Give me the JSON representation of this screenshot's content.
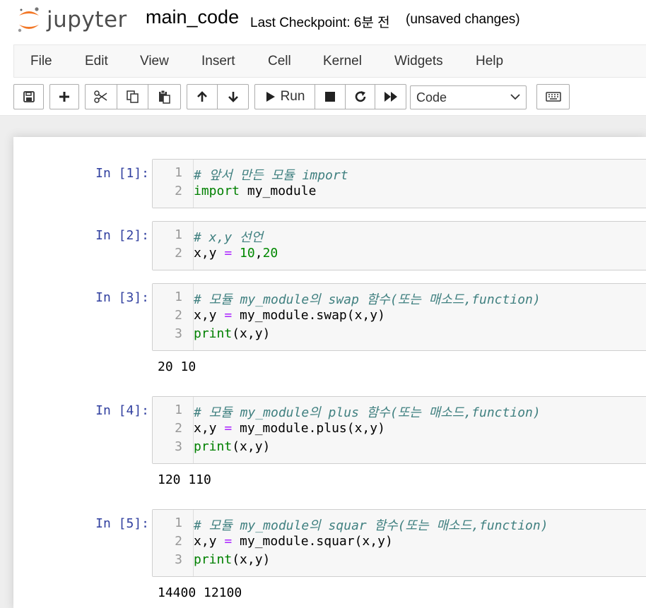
{
  "header": {
    "logo_text": "jupyter",
    "notebook_name": "main_code",
    "checkpoint": "Last Checkpoint: 6분 전",
    "unsaved": "(unsaved changes)"
  },
  "menu": [
    "File",
    "Edit",
    "View",
    "Insert",
    "Cell",
    "Kernel",
    "Widgets",
    "Help"
  ],
  "toolbar": {
    "run_label": "Run",
    "cell_type": "Code",
    "icons": [
      "save-icon",
      "plus-icon",
      "cut-icon",
      "copy-icon",
      "paste-icon",
      "arrow-up-icon",
      "arrow-down-icon",
      "run-icon",
      "stop-icon",
      "restart-icon",
      "fast-forward-icon",
      "keyboard-icon"
    ]
  },
  "colors": {
    "comment": "#408080",
    "keyword": "#008000",
    "operator": "#aa22ff",
    "number": "#008800",
    "prompt": "#303f9f"
  },
  "cells": [
    {
      "prompt": "In [1]:",
      "lines": [
        [
          {
            "t": "cm",
            "v": "# 앞서 만든 모듈 import"
          }
        ],
        [
          {
            "t": "kw",
            "v": "import"
          },
          {
            "t": "tx",
            "v": " my_module"
          }
        ]
      ],
      "output": ""
    },
    {
      "prompt": "In [2]:",
      "lines": [
        [
          {
            "t": "cm",
            "v": "# x,y 선언"
          }
        ],
        [
          {
            "t": "tx",
            "v": "x,y "
          },
          {
            "t": "op",
            "v": "="
          },
          {
            "t": "tx",
            "v": " "
          },
          {
            "t": "num",
            "v": "10"
          },
          {
            "t": "tx",
            "v": ","
          },
          {
            "t": "num",
            "v": "20"
          }
        ]
      ],
      "output": ""
    },
    {
      "prompt": "In [3]:",
      "lines": [
        [
          {
            "t": "cm",
            "v": "# 모듈 my_module의 swap 함수(또는 매소드,function)"
          }
        ],
        [
          {
            "t": "tx",
            "v": "x,y "
          },
          {
            "t": "op",
            "v": "="
          },
          {
            "t": "tx",
            "v": " my_module.swap(x,y)"
          }
        ],
        [
          {
            "t": "kw",
            "v": "print"
          },
          {
            "t": "tx",
            "v": "(x,y)"
          }
        ]
      ],
      "output": "20 10"
    },
    {
      "prompt": "In [4]:",
      "lines": [
        [
          {
            "t": "cm",
            "v": "# 모듈 my_module의 plus 함수(또는 매소드,function)"
          }
        ],
        [
          {
            "t": "tx",
            "v": "x,y "
          },
          {
            "t": "op",
            "v": "="
          },
          {
            "t": "tx",
            "v": " my_module.plus(x,y)"
          }
        ],
        [
          {
            "t": "kw",
            "v": "print"
          },
          {
            "t": "tx",
            "v": "(x,y)"
          }
        ]
      ],
      "output": "120 110"
    },
    {
      "prompt": "In [5]:",
      "lines": [
        [
          {
            "t": "cm",
            "v": "# 모듈 my_module의 squar 함수(또는 매소드,function)"
          }
        ],
        [
          {
            "t": "tx",
            "v": "x,y "
          },
          {
            "t": "op",
            "v": "="
          },
          {
            "t": "tx",
            "v": " my_module.squar(x,y)"
          }
        ],
        [
          {
            "t": "kw",
            "v": "print"
          },
          {
            "t": "tx",
            "v": "(x,y)"
          }
        ]
      ],
      "output": "14400 12100"
    }
  ]
}
